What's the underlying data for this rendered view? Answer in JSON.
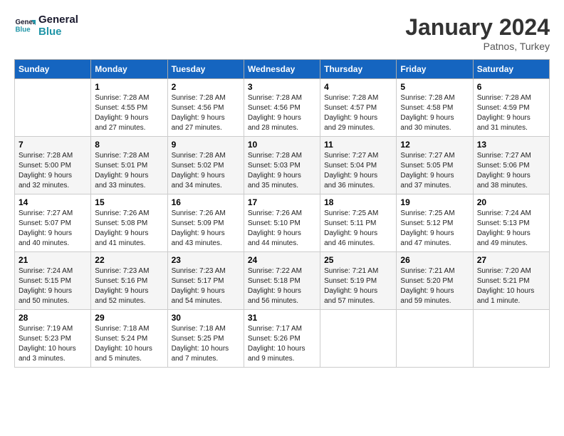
{
  "header": {
    "logo_line1": "General",
    "logo_line2": "Blue",
    "month": "January 2024",
    "location": "Patnos, Turkey"
  },
  "days_of_week": [
    "Sunday",
    "Monday",
    "Tuesday",
    "Wednesday",
    "Thursday",
    "Friday",
    "Saturday"
  ],
  "weeks": [
    [
      {
        "day": "",
        "content": ""
      },
      {
        "day": "1",
        "content": "Sunrise: 7:28 AM\nSunset: 4:55 PM\nDaylight: 9 hours\nand 27 minutes."
      },
      {
        "day": "2",
        "content": "Sunrise: 7:28 AM\nSunset: 4:56 PM\nDaylight: 9 hours\nand 27 minutes."
      },
      {
        "day": "3",
        "content": "Sunrise: 7:28 AM\nSunset: 4:56 PM\nDaylight: 9 hours\nand 28 minutes."
      },
      {
        "day": "4",
        "content": "Sunrise: 7:28 AM\nSunset: 4:57 PM\nDaylight: 9 hours\nand 29 minutes."
      },
      {
        "day": "5",
        "content": "Sunrise: 7:28 AM\nSunset: 4:58 PM\nDaylight: 9 hours\nand 30 minutes."
      },
      {
        "day": "6",
        "content": "Sunrise: 7:28 AM\nSunset: 4:59 PM\nDaylight: 9 hours\nand 31 minutes."
      }
    ],
    [
      {
        "day": "7",
        "content": "Sunrise: 7:28 AM\nSunset: 5:00 PM\nDaylight: 9 hours\nand 32 minutes."
      },
      {
        "day": "8",
        "content": "Sunrise: 7:28 AM\nSunset: 5:01 PM\nDaylight: 9 hours\nand 33 minutes."
      },
      {
        "day": "9",
        "content": "Sunrise: 7:28 AM\nSunset: 5:02 PM\nDaylight: 9 hours\nand 34 minutes."
      },
      {
        "day": "10",
        "content": "Sunrise: 7:28 AM\nSunset: 5:03 PM\nDaylight: 9 hours\nand 35 minutes."
      },
      {
        "day": "11",
        "content": "Sunrise: 7:27 AM\nSunset: 5:04 PM\nDaylight: 9 hours\nand 36 minutes."
      },
      {
        "day": "12",
        "content": "Sunrise: 7:27 AM\nSunset: 5:05 PM\nDaylight: 9 hours\nand 37 minutes."
      },
      {
        "day": "13",
        "content": "Sunrise: 7:27 AM\nSunset: 5:06 PM\nDaylight: 9 hours\nand 38 minutes."
      }
    ],
    [
      {
        "day": "14",
        "content": "Sunrise: 7:27 AM\nSunset: 5:07 PM\nDaylight: 9 hours\nand 40 minutes."
      },
      {
        "day": "15",
        "content": "Sunrise: 7:26 AM\nSunset: 5:08 PM\nDaylight: 9 hours\nand 41 minutes."
      },
      {
        "day": "16",
        "content": "Sunrise: 7:26 AM\nSunset: 5:09 PM\nDaylight: 9 hours\nand 43 minutes."
      },
      {
        "day": "17",
        "content": "Sunrise: 7:26 AM\nSunset: 5:10 PM\nDaylight: 9 hours\nand 44 minutes."
      },
      {
        "day": "18",
        "content": "Sunrise: 7:25 AM\nSunset: 5:11 PM\nDaylight: 9 hours\nand 46 minutes."
      },
      {
        "day": "19",
        "content": "Sunrise: 7:25 AM\nSunset: 5:12 PM\nDaylight: 9 hours\nand 47 minutes."
      },
      {
        "day": "20",
        "content": "Sunrise: 7:24 AM\nSunset: 5:13 PM\nDaylight: 9 hours\nand 49 minutes."
      }
    ],
    [
      {
        "day": "21",
        "content": "Sunrise: 7:24 AM\nSunset: 5:15 PM\nDaylight: 9 hours\nand 50 minutes."
      },
      {
        "day": "22",
        "content": "Sunrise: 7:23 AM\nSunset: 5:16 PM\nDaylight: 9 hours\nand 52 minutes."
      },
      {
        "day": "23",
        "content": "Sunrise: 7:23 AM\nSunset: 5:17 PM\nDaylight: 9 hours\nand 54 minutes."
      },
      {
        "day": "24",
        "content": "Sunrise: 7:22 AM\nSunset: 5:18 PM\nDaylight: 9 hours\nand 56 minutes."
      },
      {
        "day": "25",
        "content": "Sunrise: 7:21 AM\nSunset: 5:19 PM\nDaylight: 9 hours\nand 57 minutes."
      },
      {
        "day": "26",
        "content": "Sunrise: 7:21 AM\nSunset: 5:20 PM\nDaylight: 9 hours\nand 59 minutes."
      },
      {
        "day": "27",
        "content": "Sunrise: 7:20 AM\nSunset: 5:21 PM\nDaylight: 10 hours\nand 1 minute."
      }
    ],
    [
      {
        "day": "28",
        "content": "Sunrise: 7:19 AM\nSunset: 5:23 PM\nDaylight: 10 hours\nand 3 minutes."
      },
      {
        "day": "29",
        "content": "Sunrise: 7:18 AM\nSunset: 5:24 PM\nDaylight: 10 hours\nand 5 minutes."
      },
      {
        "day": "30",
        "content": "Sunrise: 7:18 AM\nSunset: 5:25 PM\nDaylight: 10 hours\nand 7 minutes."
      },
      {
        "day": "31",
        "content": "Sunrise: 7:17 AM\nSunset: 5:26 PM\nDaylight: 10 hours\nand 9 minutes."
      },
      {
        "day": "",
        "content": ""
      },
      {
        "day": "",
        "content": ""
      },
      {
        "day": "",
        "content": ""
      }
    ]
  ]
}
